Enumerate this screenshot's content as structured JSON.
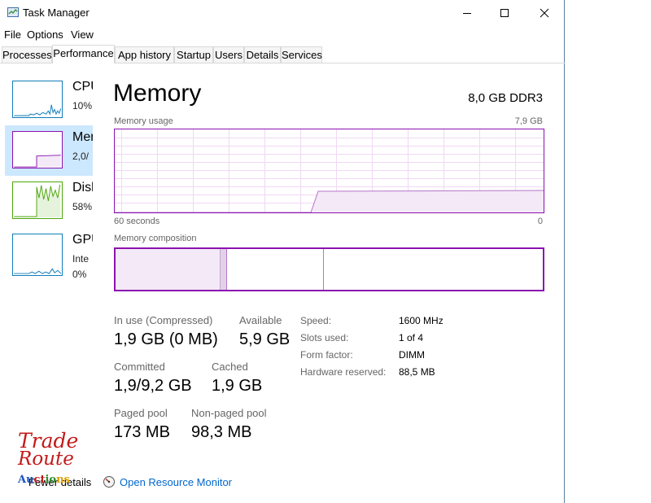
{
  "window": {
    "title": "Task Manager"
  },
  "menu": {
    "file": "File",
    "options": "Options",
    "view": "View"
  },
  "tabs": [
    {
      "label": "Processes"
    },
    {
      "label": "Performance"
    },
    {
      "label": "App history"
    },
    {
      "label": "Startup"
    },
    {
      "label": "Users"
    },
    {
      "label": "Details"
    },
    {
      "label": "Services"
    }
  ],
  "active_tab": "Performance",
  "sidebar": {
    "items": [
      {
        "name": "CPU",
        "value": "10%"
      },
      {
        "name": "Memory",
        "value": "2,0/"
      },
      {
        "name": "Disk",
        "value": "58%"
      },
      {
        "name": "GPU",
        "value": "Inte",
        "value2": "0%"
      }
    ],
    "selected": "Memory"
  },
  "memory": {
    "title": "Memory",
    "spec": "8,0 GB DDR3",
    "usage_label": "Memory usage",
    "usage_max": "7,9 GB",
    "time_left": "60 seconds",
    "time_right": "0",
    "composition_label": "Memory composition",
    "in_use_label": "In use (Compressed)",
    "in_use_value": "1,9 GB (0 MB)",
    "available_label": "Available",
    "available_value": "5,9 GB",
    "committed_label": "Committed",
    "committed_value": "1,9/9,2 GB",
    "cached_label": "Cached",
    "cached_value": "1,9 GB",
    "paged_label": "Paged pool",
    "paged_value": "173 MB",
    "nonpaged_label": "Non-paged pool",
    "nonpaged_value": "98,3 MB",
    "details": [
      {
        "label": "Speed:",
        "value": "1600 MHz"
      },
      {
        "label": "Slots used:",
        "value": "1 of 4"
      },
      {
        "label": "Form factor:",
        "value": "DIMM"
      },
      {
        "label": "Hardware reserved:",
        "value": "88,5 MB"
      }
    ]
  },
  "footer": {
    "fewer_details": "Fewer details",
    "open_resource_monitor": "Open Resource Monitor"
  },
  "watermark": {
    "line1": "Trade",
    "line2": "Route",
    "line3": "Auctions"
  },
  "colors": {
    "memory_accent": "#8b12ae",
    "cpu_accent": "#117dbb",
    "disk_accent": "#4da60c",
    "selection": "#cce8ff",
    "link": "#0066cc"
  }
}
